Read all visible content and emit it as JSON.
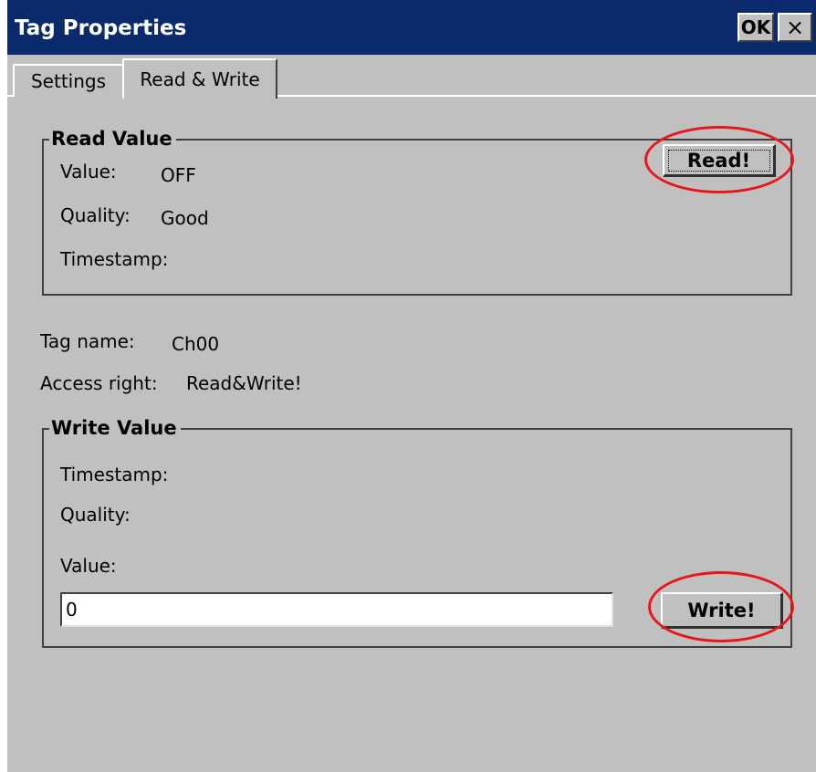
{
  "window": {
    "title": "Tag Properties",
    "ok_label": "OK",
    "close_label": "×"
  },
  "tabs": [
    {
      "label": "Settings",
      "active": false
    },
    {
      "label": "Read & Write",
      "active": true
    }
  ],
  "read_group": {
    "title": "Read Value",
    "value_label": "Value:",
    "value": "OFF",
    "quality_label": "Quality:",
    "quality": "Good",
    "timestamp_label": "Timestamp:",
    "read_button": "Read!"
  },
  "tag_info": {
    "name_label": "Tag name:",
    "name": "Ch00",
    "access_label": "Access right:",
    "access": "Read&Write!"
  },
  "write_group": {
    "title": "Write Value",
    "timestamp_label": "Timestamp:",
    "quality_label": "Quality:",
    "value_label": "Value:",
    "input_value": "0",
    "write_button": "Write!"
  },
  "annotations": {
    "highlight_color": "#e8161b"
  }
}
